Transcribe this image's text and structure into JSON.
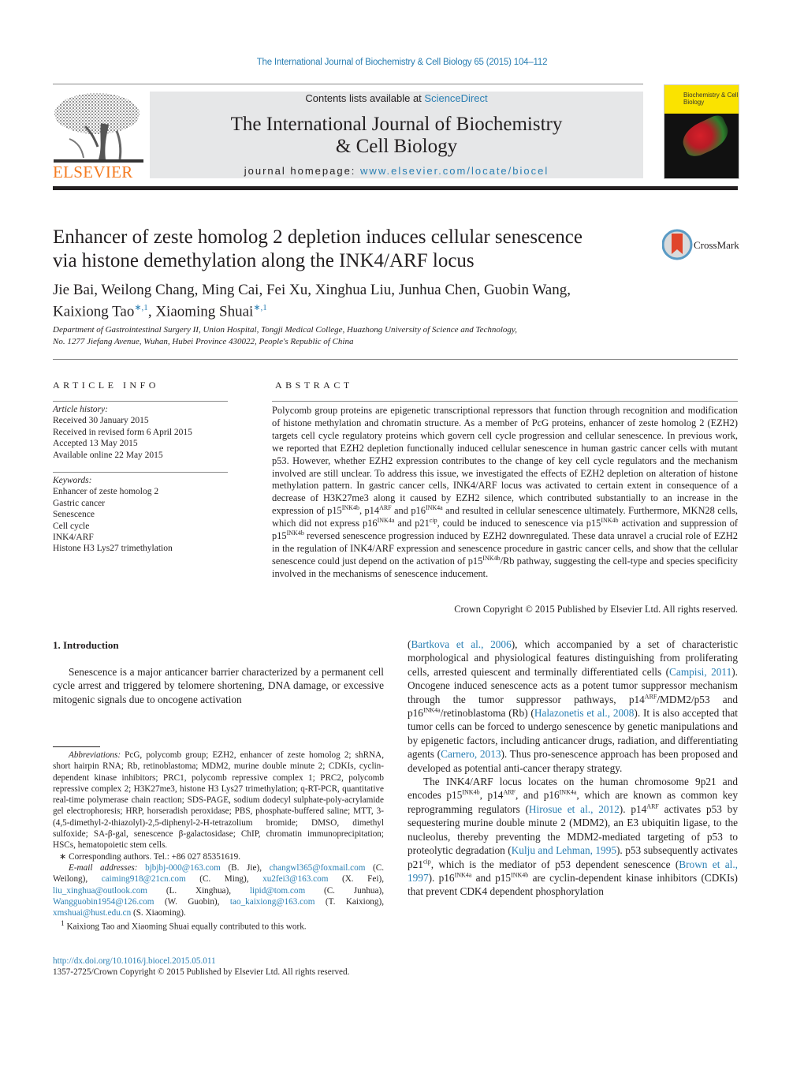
{
  "running_head": "The International Journal of Biochemistry & Cell Biology 65 (2015) 104–112",
  "header": {
    "publisher_logo": "ELSEVIER",
    "contents_prefix": "Contents lists available at ",
    "contents_link": "ScienceDirect",
    "journal_title_line1": "The International Journal of Biochemistry",
    "journal_title_line2": "& Cell Biology",
    "homepage_prefix": "journal homepage: ",
    "homepage_link": "www.elsevier.com/locate/biocel",
    "cover_title": "Biochemistry & Cell Biology",
    "crossmark_label": "CrossMark",
    "colors": {
      "link": "#2a7fb3",
      "elsevier_orange": "#f47b20",
      "banner_gray": "#e6e7e8",
      "cover_yellow": "#fae300"
    }
  },
  "article": {
    "title_line1": "Enhancer of zeste homolog 2 depletion induces cellular senescence",
    "title_line2": "via histone demethylation along the INK4/ARF locus",
    "authors_line1": "Jie Bai, Weilong Chang, Ming Cai, Fei Xu, Xinghua Liu, Junhua Chen, Guobin Wang,",
    "author_tao": "Kaixiong Tao",
    "author_shuai": "Xiaoming Shuai",
    "author_marks": "∗,1",
    "affiliation_line1": "Department of Gastrointestinal Surgery II, Union Hospital, Tongji Medical College, Huazhong University of Science and Technology,",
    "affiliation_line2": "No. 1277 Jiefang Avenue, Wuhan, Hubei Province 430022, People's Republic of China"
  },
  "article_info": {
    "heading": "ARTICLE INFO",
    "history_label": "Article history:",
    "history": [
      "Received 30 January 2015",
      "Received in revised form 6 April 2015",
      "Accepted 13 May 2015",
      "Available online 22 May 2015"
    ],
    "keywords_label": "Keywords:",
    "keywords": [
      "Enhancer of zeste homolog 2",
      "Gastric cancer",
      "Senescence",
      "Cell cycle",
      "INK4/ARF",
      "Histone H3 Lys27 trimethylation"
    ]
  },
  "abstract": {
    "heading": "ABSTRACT",
    "s1": "Polycomb group proteins are epigenetic transcriptional repressors that function through recognition and modification of histone methylation and chromatin structure. As a member of PcG proteins, enhancer of zeste homolog 2 (EZH2) targets cell cycle regulatory proteins which govern cell cycle progression and cellular senescence. In previous work, we reported that EZH2 depletion functionally induced cellular senescence in human gastric cancer cells with mutant p53. However, whether EZH2 expression contributes to the change of key cell cycle regulators and the mechanism involved are still unclear. To address this issue, we investigated the effects of EZH2 depletion on alteration of histone methylation pattern. In gastric cancer cells, INK4/ARF locus was activated to certain extent in consequence of a decrease of H3K27me3 along it caused by EZH2 silence, which contributed substantially to an increase in the expression of p15",
    "sup_ink4b": "INK4b",
    "t2": ", p14",
    "sup_arf": "ARF",
    "t3": " and p16",
    "sup_ink4a": "INK4a",
    "t4": " and resulted in cellular senescence ultimately. Furthermore, MKN28 cells, which did not express p16",
    "t5": " and p21",
    "sup_cip": "cip",
    "t6": ", could be induced to senescence via p15",
    "t7": " activation and suppression of p15",
    "t8": " reversed senescence progression induced by EZH2 downregulated. These data unravel a crucial role of EZH2 in the regulation of INK4/ARF expression and senescence procedure in gastric cancer cells, and show that the cellular senescence could just depend on the activation of p15",
    "t9": "/Rb pathway, suggesting the cell-type and species specificity involved in the mechanisms of senescence inducement.",
    "copyright": "Crown Copyright © 2015 Published by Elsevier Ltd. All rights reserved."
  },
  "introduction": {
    "heading": "1.  Introduction",
    "p1": "Senescence is a major anticancer barrier characterized by a permanent cell cycle arrest and triggered by telomere shortening, DNA damage, or excessive mitogenic signals due to oncogene activation",
    "r_cite1": "Bartkova et al., 2006",
    "r1a": "), which accompanied by a set of characteristic morphological and physiological features distinguishing from proliferating cells, arrested quiescent and terminally differentiated cells (",
    "r_cite2": "Campisi, 2011",
    "r1b": "). Oncogene induced senescence acts as a potent tumor suppressor mechanism through the tumor suppressor pathways, p14",
    "r1c": "/MDM2/p53 and p16",
    "r1d": "/retinoblastoma (Rb) (",
    "r_cite3": "Halazonetis et al., 2008",
    "r1e": "). It is also accepted that tumor cells can be forced to undergo senescence by genetic manipulations and by epigenetic factors, including anticancer drugs, radiation, and differentiating agents (",
    "r_cite4": "Carnero, 2013",
    "r1f": "). Thus pro-senescence approach has been proposed and developed as potential anti-cancer therapy strategy.",
    "r2a": "The INK4/ARF locus locates on the human chromosome 9p21 and encodes p15",
    "r2b": ", p14",
    "r2c": ", and p16",
    "r2d": ", which are known as common key reprogramming regulators (",
    "r_cite5": "Hirosue et al., 2012",
    "r2e": "). p14",
    "r2f": " activates p53 by sequestering murine double minute 2 (MDM2), an E3 ubiquitin ligase, to the nucleolus, thereby preventing the MDM2-mediated targeting of p53 to proteolytic degradation (",
    "r_cite6": "Kulju and Lehman, 1995",
    "r2g": "). p53 subsequently activates p21",
    "r2h": ", which is the mediator of p53 dependent senescence (",
    "r_cite7": "Brown et al., 1997",
    "r2i": "). p16",
    "r2j": " and p15",
    "r2k": " are cyclin-dependent kinase inhibitors (CDKIs) that prevent CDK4 dependent phosphorylation"
  },
  "footnotes": {
    "abbrev_label": "Abbreviations:",
    "abbrev_text": "  PcG, polycomb group; EZH2, enhancer of zeste homolog 2; shRNA, short hairpin RNA; Rb, retinoblastoma; MDM2, murine double minute 2; CDKIs, cyclin-dependent kinase inhibitors; PRC1, polycomb repressive complex 1; PRC2, polycomb repressive complex 2; H3K27me3, histone H3 Lys27 trimethylation; q-RT-PCR, quantitative real-time polymerase chain reaction; SDS-PAGE, sodium dodecyl sulphate-poly-acrylamide gel electrophoresis; HRP, horseradish peroxidase; PBS, phosphate-buffered saline; MTT, 3-(4,5-dimethyl-2-thiazolyl)-2,5-diphenyl-2-H-tetrazolium bromide; DMSO, dimethyl sulfoxide; SA-β-gal, senescence β-galactosidase; ChIP, chromatin immunoprecipitation; HSCs, hematopoietic stem cells.",
    "corresponding": "∗  Corresponding authors. Tel.: +86 027 85351619.",
    "email_label": "E-mail addresses:",
    "emails": [
      {
        "addr": "bjbjbj-000@163.com",
        "name": " (B. Jie), "
      },
      {
        "addr": "changwl365@foxmail.com",
        "name": " (C. Weilong), "
      },
      {
        "addr": "caiming918@21cn.com",
        "name": " (C. Ming), "
      },
      {
        "addr": "xu2fei3@163.com",
        "name": " (X. Fei), "
      },
      {
        "addr": "liu_xinghua@outlook.com",
        "name": " (L. Xinghua), "
      },
      {
        "addr": "lipid@tom.com",
        "name": " (C. Junhua), "
      },
      {
        "addr": "Wangguobin1954@126.com",
        "name": " (W. Guobin), "
      },
      {
        "addr": "tao_kaixiong@163.com",
        "name": " (T. Kaixiong), "
      },
      {
        "addr": "xmshuai@hust.edu.cn",
        "name": " (S. Xiaoming)."
      }
    ],
    "equal_note_mark": "1",
    "equal_note": "  Kaixiong Tao and Xiaoming Shuai equally contributed to this work.",
    "doi": "http://dx.doi.org/10.1016/j.biocel.2015.05.011",
    "issn": "1357-2725/Crown Copyright © 2015 Published by Elsevier Ltd. All rights reserved."
  }
}
